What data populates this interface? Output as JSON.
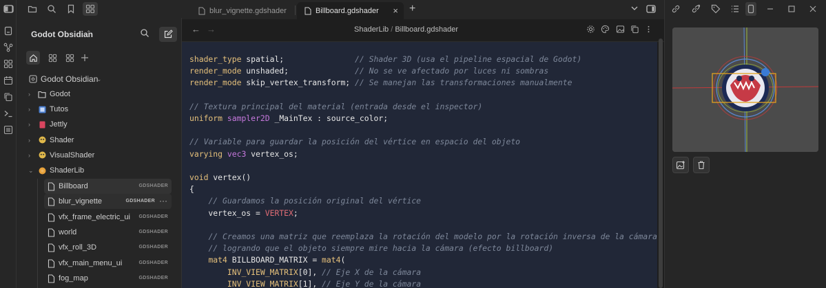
{
  "window": {
    "ribbon_icons": [
      "sidebar-toggle-icon",
      "file-icon",
      "graph-icon",
      "grid-icon",
      "calendar-icon",
      "copy-icon",
      "terminal-icon",
      "list-icon"
    ],
    "top_left_icons": [
      "sidebar-toggle-icon",
      "folder-icon",
      "search-icon",
      "bookmark-icon",
      "grid-icon"
    ]
  },
  "sidebar": {
    "vault_name": "Godot Obsidian",
    "vault_chevron": "⌃",
    "root_label": "Godot Obsidian",
    "folders": [
      {
        "label": "Godot",
        "chevron": "›",
        "icon": "folder-icon",
        "color": "#cfcfcf"
      },
      {
        "label": "Tutos",
        "chevron": "›",
        "icon": "tutos-icon",
        "color": "#4a7fd1"
      },
      {
        "label": "Jettly",
        "chevron": "›",
        "icon": "jettly-icon",
        "color": "#d9455f"
      },
      {
        "label": "Shader",
        "chevron": "›",
        "icon": "shader-icon",
        "color": "#e0b84a"
      },
      {
        "label": "VisualShader",
        "chevron": "›",
        "icon": "visualshader-icon",
        "color": "#e0b84a"
      },
      {
        "label": "ShaderLib",
        "chevron": "⌄",
        "icon": "shaderlib-icon",
        "color": "#e8a23a"
      }
    ],
    "files": [
      {
        "label": "Billboard",
        "badge": "GDSHADER"
      },
      {
        "label": "blur_vignette",
        "badge": "GDSHADER"
      },
      {
        "label": "vfx_frame_electric_ui",
        "badge": "GDSHADER"
      },
      {
        "label": "world",
        "badge": "GDSHADER"
      },
      {
        "label": "vfx_roll_3D",
        "badge": "GDSHADER"
      },
      {
        "label": "vfx_main_menu_ui",
        "badge": "GDSHADER"
      },
      {
        "label": "fog_map",
        "badge": "GDSHADER"
      }
    ],
    "more_dots": "···"
  },
  "tabs": [
    {
      "label": "blur_vignette.gdshader",
      "active": false
    },
    {
      "label": "Billboard.gdshader",
      "active": true
    }
  ],
  "tab_close": "×",
  "tab_new": "+",
  "breadcrumb": {
    "folder": "ShaderLib",
    "separator": "/",
    "file": "Billboard.gdshader"
  },
  "code_lines": [
    [
      {
        "c": "kw",
        "t": "shader_type"
      },
      {
        "c": "tx",
        "t": " spatial;               "
      },
      {
        "c": "cm",
        "t": "// Shader 3D (usa el pipeline espacial de Godot)"
      }
    ],
    [
      {
        "c": "kw",
        "t": "render_mode"
      },
      {
        "c": "tx",
        "t": " unshaded;              "
      },
      {
        "c": "cm",
        "t": "// No se ve afectado por luces ni sombras"
      }
    ],
    [
      {
        "c": "kw",
        "t": "render_mode"
      },
      {
        "c": "tx",
        "t": " skip_vertex_transform; "
      },
      {
        "c": "cm",
        "t": "// Se manejan las transformaciones manualmente"
      }
    ],
    [],
    [
      {
        "c": "cm",
        "t": "// Textura principal del material (entrada desde el inspector)"
      }
    ],
    [
      {
        "c": "kw",
        "t": "uniform"
      },
      {
        "c": "tx",
        "t": " "
      },
      {
        "c": "ty",
        "t": "sampler2D"
      },
      {
        "c": "tx",
        "t": " _MainTex : source_color;"
      }
    ],
    [],
    [
      {
        "c": "cm",
        "t": "// Variable para guardar la posición del vértice en espacio del objeto"
      }
    ],
    [
      {
        "c": "kw",
        "t": "varying"
      },
      {
        "c": "tx",
        "t": " "
      },
      {
        "c": "ty",
        "t": "vec3"
      },
      {
        "c": "tx",
        "t": " vertex_os;"
      }
    ],
    [],
    [
      {
        "c": "kw",
        "t": "void"
      },
      {
        "c": "tx",
        "t": " vertex()"
      }
    ],
    [
      {
        "c": "tx",
        "t": "{"
      }
    ],
    [
      {
        "c": "tx",
        "t": "    "
      },
      {
        "c": "cm",
        "t": "// Guardamos la posición original del vértice"
      }
    ],
    [
      {
        "c": "tx",
        "t": "    vertex_os = "
      },
      {
        "c": "bi",
        "t": "VERTEX"
      },
      {
        "c": "tx",
        "t": ";"
      }
    ],
    [],
    [
      {
        "c": "tx",
        "t": "    "
      },
      {
        "c": "cm",
        "t": "// Creamos una matriz que reemplaza la rotación del modelo por la rotación inversa de la cámara,"
      }
    ],
    [
      {
        "c": "tx",
        "t": "    "
      },
      {
        "c": "cm",
        "t": "// logrando que el objeto siempre mire hacia la cámara (efecto billboard)"
      }
    ],
    [
      {
        "c": "tx",
        "t": "    "
      },
      {
        "c": "kw",
        "t": "mat4"
      },
      {
        "c": "tx",
        "t": " BILLBOARD_MATRIX = "
      },
      {
        "c": "kw",
        "t": "mat4"
      },
      {
        "c": "tx",
        "t": "("
      }
    ],
    [
      {
        "c": "tx",
        "t": "        "
      },
      {
        "c": "kw",
        "t": "INV_VIEW_MATRIX"
      },
      {
        "c": "tx",
        "t": "[0], "
      },
      {
        "c": "cm",
        "t": "// Eje X de la cámara"
      }
    ],
    [
      {
        "c": "tx",
        "t": "        "
      },
      {
        "c": "kw",
        "t": "INV_VIEW_MATRIX"
      },
      {
        "c": "tx",
        "t": "[1], "
      },
      {
        "c": "cm",
        "t": "// Eje Y de la cámara"
      }
    ]
  ],
  "colors": {
    "code_bg": "#212737",
    "keyword": "#e5c07b",
    "type": "#c678dd",
    "comment": "#7d8799",
    "builtin": "#e06c75",
    "text": "#e6e6e6"
  }
}
